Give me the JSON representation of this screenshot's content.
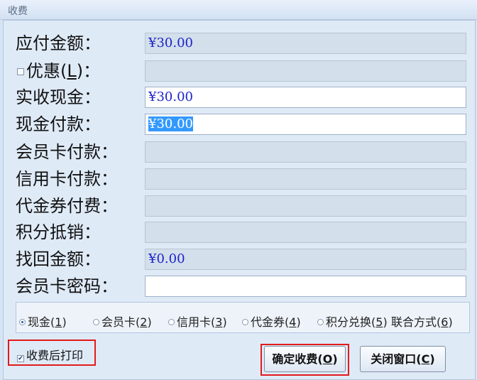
{
  "window": {
    "title": "收费"
  },
  "fields": [
    {
      "label": "应付金额：",
      "value": "¥30.00"
    },
    {
      "label_prefix": "优惠(",
      "label_key": "L",
      "label_suffix": ")：",
      "value": ""
    },
    {
      "label": "实收现金：",
      "value": "¥30.00"
    },
    {
      "label": "现金付款：",
      "value": "¥30.00"
    },
    {
      "label": "会员卡付款：",
      "value": ""
    },
    {
      "label": "信用卡付款：",
      "value": ""
    },
    {
      "label": "代金券付费：",
      "value": ""
    },
    {
      "label": "积分抵销：",
      "value": ""
    },
    {
      "label": "找回金额：",
      "value": "¥0.00"
    },
    {
      "label": "会员卡密码：",
      "value": ""
    }
  ],
  "payment_methods": [
    {
      "label": "现金(",
      "key": "1",
      "end": ")",
      "selected": true
    },
    {
      "label": "会员卡(",
      "key": "2",
      "end": ")",
      "selected": false
    },
    {
      "label": "信用卡(",
      "key": "3",
      "end": ")",
      "selected": false
    },
    {
      "label": "代金券(",
      "key": "4",
      "end": ")",
      "selected": false
    },
    {
      "label": "积分兑换(",
      "key": "5",
      "end": ")",
      "selected": false
    },
    {
      "label": "联合方式(",
      "key": "6",
      "end": ")",
      "selected": false
    }
  ],
  "print_after": {
    "label": "收费后打印",
    "checked": true
  },
  "buttons": {
    "confirm": {
      "label": "确定收费(",
      "key": "O",
      "end": ")"
    },
    "close": {
      "label": "关闭窗口(",
      "key": "C",
      "end": ")"
    }
  },
  "colors": {
    "highlight": "#e21b1b",
    "amount_text": "#1d24c8",
    "selection": "#3399ff"
  }
}
